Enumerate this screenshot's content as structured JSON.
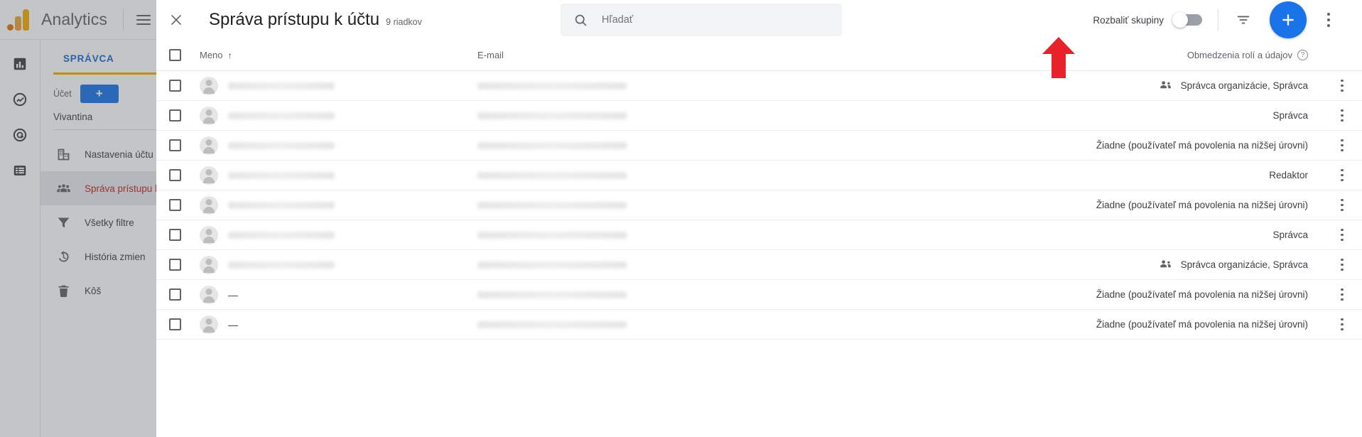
{
  "app": {
    "brand": "Analytics",
    "rail_icons": [
      "bar-chart-icon",
      "insights-icon",
      "advertising-icon",
      "list-icon"
    ],
    "tab_label": "SPRÁVCA",
    "account_label": "Účet",
    "account_add_label": "+",
    "account_name": "Vivantina",
    "menu_items": [
      {
        "label": "Nastavenia účtu",
        "icon": "building-icon",
        "selected": false
      },
      {
        "label": "Správa prístupu k účtu",
        "icon": "people-icon",
        "selected": true
      },
      {
        "label": "Všetky filtre",
        "icon": "filter-icon",
        "selected": false
      },
      {
        "label": "História zmien",
        "icon": "history-icon",
        "selected": false
      },
      {
        "label": "Kôš",
        "icon": "trash-icon",
        "selected": false
      }
    ]
  },
  "modal": {
    "close_icon": "close-icon",
    "title": "Správa prístupu k účtu",
    "rows_count": "9 riadkov",
    "search": {
      "icon": "search-icon",
      "placeholder": "Hľadať",
      "value": ""
    },
    "toggle": {
      "label": "Rozbaliť skupiny",
      "state": "off"
    },
    "filter_icon": "filter-list-icon",
    "add_button_icon": "plus-icon",
    "add_button_color": "#1a73e8",
    "overflow_icon": "more-vert-icon"
  },
  "table": {
    "columns": {
      "name": "Meno",
      "name_sort": "↑",
      "email": "E-mail",
      "roles": "Obmedzenia rolí a údajov",
      "roles_help": "?"
    },
    "rows": [
      {
        "name": "",
        "email": "",
        "role": "Správca organizácie, Správca",
        "has_group_icon": true
      },
      {
        "name": "",
        "email": "",
        "role": "Správca",
        "has_group_icon": false
      },
      {
        "name": "",
        "email": "",
        "role": "Žiadne (používateľ má povolenia na nižšej úrovni)",
        "has_group_icon": false
      },
      {
        "name": "",
        "email": "",
        "role": "Redaktor",
        "has_group_icon": false
      },
      {
        "name": "",
        "email": "",
        "role": "Žiadne (používateľ má povolenia na nižšej úrovni)",
        "has_group_icon": false
      },
      {
        "name": "",
        "email": "",
        "role": "Správca",
        "has_group_icon": false
      },
      {
        "name": "",
        "email": "",
        "role": "Správca organizácie, Správca",
        "has_group_icon": true
      },
      {
        "name": "—",
        "email": "",
        "role": "Žiadne (používateľ má povolenia na nižšej úrovni)",
        "has_group_icon": false
      },
      {
        "name": "—",
        "email": "",
        "role": "Žiadne (používateľ má povolenia na nižšej úrovni)",
        "has_group_icon": false
      }
    ]
  },
  "annotation": {
    "arrow_color": "#e8222a",
    "points_at": "add-user-button"
  }
}
